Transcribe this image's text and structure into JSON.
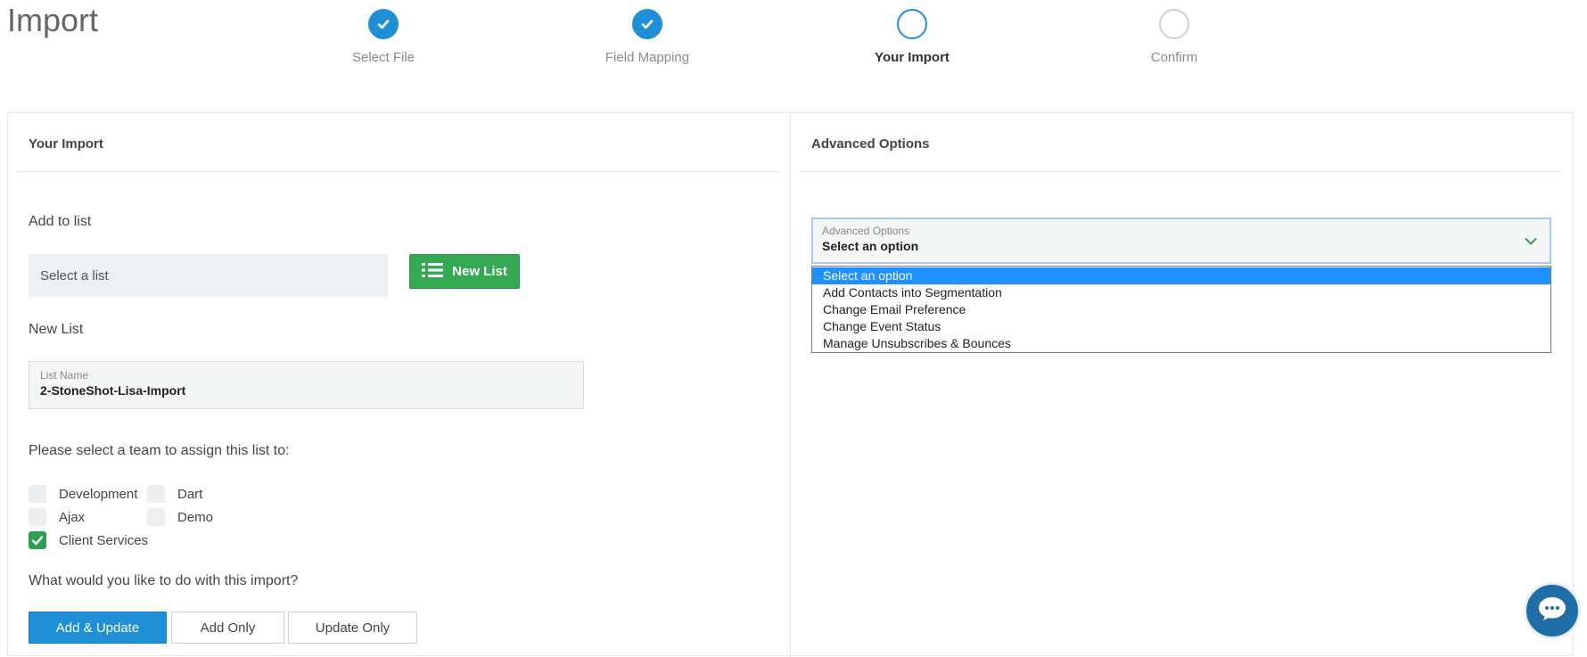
{
  "page": {
    "title": "Import"
  },
  "steps": [
    {
      "label": "Select File",
      "state": "done"
    },
    {
      "label": "Field Mapping",
      "state": "done"
    },
    {
      "label": "Your Import",
      "state": "current"
    },
    {
      "label": "Confirm",
      "state": "pending"
    }
  ],
  "import_panel": {
    "title": "Your Import",
    "add_to_list_label": "Add to list",
    "select_list_placeholder": "Select a list",
    "new_list_button": "New List",
    "new_list_label": "New List",
    "list_name_label": "List Name",
    "list_name_value": "2-StoneShot-Lisa-Import",
    "team_prompt": "Please select a team to assign this list to:",
    "teams": [
      {
        "label": "Development",
        "checked": false
      },
      {
        "label": "Dart",
        "checked": false
      },
      {
        "label": "Ajax",
        "checked": false
      },
      {
        "label": "Demo",
        "checked": false
      },
      {
        "label": "Client Services",
        "checked": true
      }
    ],
    "action_prompt": "What would you like to do with this import?",
    "actions": [
      {
        "label": "Add & Update",
        "active": true
      },
      {
        "label": "Add Only",
        "active": false
      },
      {
        "label": "Update Only",
        "active": false
      }
    ]
  },
  "advanced_panel": {
    "title": "Advanced Options",
    "select_label": "Advanced Options",
    "selected_value": "Select an option",
    "options": [
      "Select an option",
      "Add Contacts into Segmentation",
      "Change Email Preference",
      "Change Event Status",
      "Manage Unsubscribes & Bounces"
    ],
    "highlighted_index": 0
  },
  "colors": {
    "primary": "#1e8fd5",
    "success": "#34a853",
    "highlight": "#1e90ff",
    "chat": "#1f6ea8"
  },
  "icons": {
    "step_done": "check-icon",
    "new_list": "list-icon",
    "dropdown": "chevron-down-icon",
    "chat": "chat-bubble-icon"
  }
}
